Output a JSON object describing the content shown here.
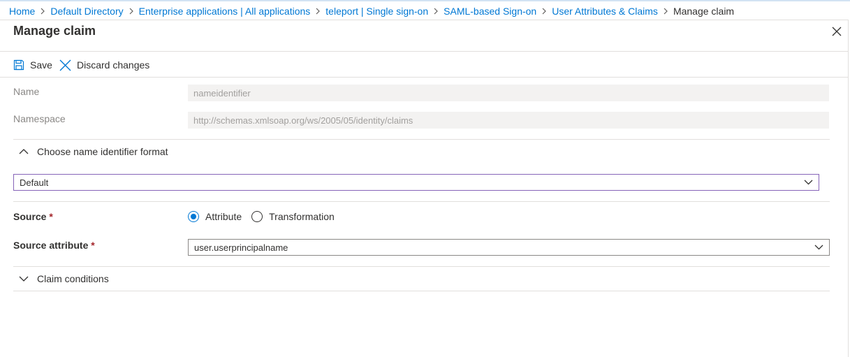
{
  "breadcrumb": {
    "items": [
      {
        "label": "Home"
      },
      {
        "label": "Default Directory"
      },
      {
        "label": "Enterprise applications | All applications"
      },
      {
        "label": "teleport | Single sign-on"
      },
      {
        "label": "SAML-based Sign-on"
      },
      {
        "label": "User Attributes & Claims"
      }
    ],
    "current": "Manage claim"
  },
  "blade": {
    "title": "Manage claim"
  },
  "toolbar": {
    "save_label": "Save",
    "discard_label": "Discard changes"
  },
  "form": {
    "name": {
      "label": "Name",
      "value": "nameidentifier"
    },
    "namespace": {
      "label": "Namespace",
      "value": "http://schemas.xmlsoap.org/ws/2005/05/identity/claims"
    },
    "name_identifier_format": {
      "label": "Choose name identifier format",
      "expanded": true,
      "selected": "Default"
    },
    "source": {
      "label": "Source",
      "required_mark": "*",
      "options": [
        {
          "label": "Attribute",
          "checked": true
        },
        {
          "label": "Transformation",
          "checked": false
        }
      ]
    },
    "source_attribute": {
      "label": "Source attribute",
      "required_mark": "*",
      "selected": "user.userprincipalname"
    },
    "claim_conditions": {
      "label": "Claim conditions",
      "expanded": false
    }
  },
  "icons": {
    "separator": "chevron-right-icon",
    "close": "close-icon",
    "save": "save-icon",
    "discard": "discard-icon",
    "collapse": "chevron-up-icon",
    "expand": "chevron-down-icon"
  },
  "colors": {
    "link": "#0078d4",
    "text": "#323130",
    "disabled_text": "#a19f9d",
    "disabled_bg": "#f3f2f1",
    "focus_border": "#8764b8",
    "required": "#a4262c",
    "divider": "#e1dfdd"
  }
}
